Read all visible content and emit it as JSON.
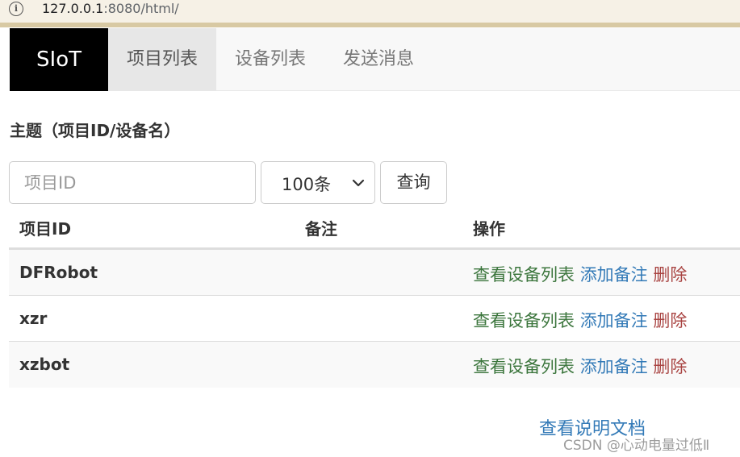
{
  "browser": {
    "url_host": "127.0.0.1",
    "url_rest": ":8080/html/",
    "info_icon": "info-icon"
  },
  "navbar": {
    "brand": "SIoT",
    "items": [
      {
        "label": "项目列表",
        "active": true
      },
      {
        "label": "设备列表",
        "active": false
      },
      {
        "label": "发送消息",
        "active": false
      }
    ]
  },
  "topic_label": "主题（项目ID/设备名）",
  "search": {
    "placeholder": "项目ID",
    "value": "",
    "count_selected": "100条",
    "query_label": "查询"
  },
  "table": {
    "headers": [
      "项目ID",
      "备注",
      "操作"
    ],
    "rows": [
      {
        "id": "DFRobot",
        "note": ""
      },
      {
        "id": "xzr",
        "note": ""
      },
      {
        "id": "xzbot",
        "note": ""
      }
    ],
    "actions": {
      "view": "查看设备列表",
      "add_note": "添加备注",
      "delete": "删除"
    }
  },
  "footer": {
    "doc_link": "查看说明文档",
    "watermark": "CSDN @心动电量过低Ⅱ"
  },
  "colors": {
    "brand_bg": "#000000",
    "view_link": "#3c763d",
    "note_link": "#337ab7",
    "delete_link": "#a94442"
  }
}
